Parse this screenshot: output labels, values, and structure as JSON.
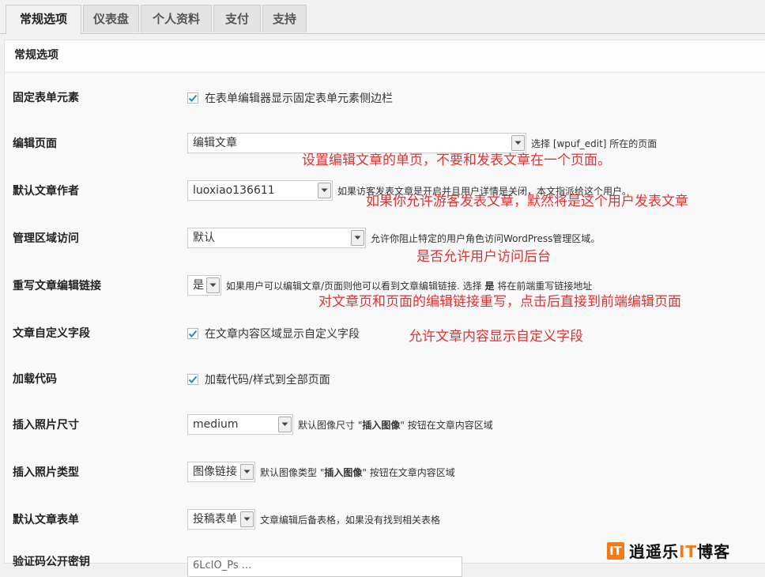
{
  "tabs": [
    "常规选项",
    "仪表盘",
    "个人资料",
    "支付",
    "支持"
  ],
  "panel_title": "常规选项",
  "rows": {
    "sticky": {
      "label": "固定表单元素",
      "text": "在表单编辑器显示固定表单元素侧边栏",
      "checked": true
    },
    "edit_page": {
      "label": "编辑页面",
      "value": "编辑文章",
      "desc": "选择 [wpuf_edit] 所在的页面"
    },
    "author": {
      "label": "默认文章作者",
      "value": "luoxiao136611",
      "desc": "如果访客发表文章是开启并且用户详情是关闭，本文指派给这个用户。"
    },
    "admin": {
      "label": "管理区域访问",
      "value": "默认",
      "desc": "允许你阻止特定的用户角色访问WordPress管理区域。"
    },
    "override": {
      "label": "重写文章编辑链接",
      "value": "是",
      "desc_a": "如果用户可以编辑文章/页面则他可以看到文章编辑链接. 选择 ",
      "desc_b": "是",
      "desc_c": " 将在前端重写链接地址"
    },
    "custom": {
      "label": "文章自定义字段",
      "text": "在文章内容区域显示自定义字段",
      "checked": true
    },
    "load": {
      "label": "加载代码",
      "text": "加载代码/样式到全部页面",
      "checked": true
    },
    "img_size": {
      "label": "插入照片尺寸",
      "value": "medium",
      "desc_a": "默认图像尺寸 \"",
      "desc_b": "插入图像",
      "desc_c": "\" 按钮在文章内容区域"
    },
    "img_type": {
      "label": "插入照片类型",
      "value": "图像链接",
      "desc_a": "默认图像类型 \"",
      "desc_b": "插入图像",
      "desc_c": "\" 按钮在文章内容区域"
    },
    "form": {
      "label": "默认文章表单",
      "value": "投稿表单",
      "desc": "文章编辑后备表格，如果没有找到相关表格"
    },
    "recaptcha": {
      "label": "验证码公开密钥",
      "value": "6LcIO_Ps ... "
    }
  },
  "annotations": {
    "a1": "设置编辑文章的单页，不要和发表文章在一个页面。",
    "a2": "如果你允许游客发表文章，默然将是这个用户发表文章",
    "a3": "是否允许用户访问后台",
    "a4": "对文章页和页面的编辑链接重写，点击后直接到前端编辑页面",
    "a5": "允许文章内容显示自定义字段"
  },
  "watermark": {
    "mark": "IT",
    "text_a": "逍遥乐",
    "text_b": "IT",
    "text_c": "博客"
  },
  "colors": {
    "annotation": "#e43030",
    "check": "#1e8cbe",
    "brand": "#f27a1b"
  }
}
